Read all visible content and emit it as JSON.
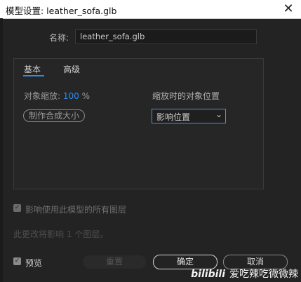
{
  "window": {
    "title": "模型设置: leather_sofa.glb",
    "close": "✕"
  },
  "name": {
    "label": "名称:",
    "value": "leather_sofa.glb"
  },
  "tabs": [
    {
      "label": "基本",
      "active": true
    },
    {
      "label": "高级",
      "active": false
    }
  ],
  "scale": {
    "label": "对象缩放:",
    "value": "100",
    "unit": "%"
  },
  "size_button": "制作合成大小",
  "position": {
    "label": "缩放时的对象位置",
    "selected": "影响位置"
  },
  "affect": {
    "label": "影响使用此模型的所有图层",
    "checked": true,
    "note": "此更改将影响 1 个图层。"
  },
  "preview": {
    "label": "预览",
    "checked": true
  },
  "buttons": {
    "reset": "重置",
    "ok": "确定",
    "cancel": "取消"
  },
  "watermark": {
    "logo": "bilibili",
    "text": "爱吃辣吃微微辣"
  },
  "colors": {
    "accent": "#2d8ceb",
    "background": "#232323"
  }
}
